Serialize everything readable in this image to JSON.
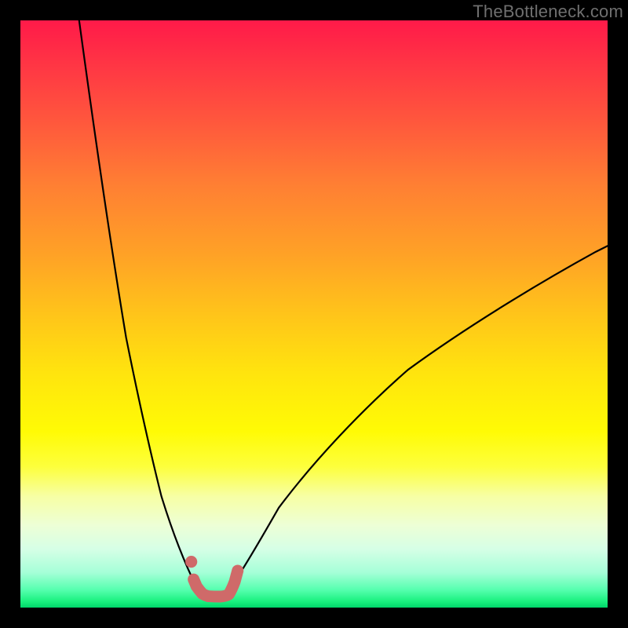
{
  "watermark": {
    "text": "TheBottleneck.com"
  },
  "chart_data": {
    "type": "line",
    "title": "",
    "xlabel": "",
    "ylabel": "",
    "xlim": [
      0,
      100
    ],
    "ylim": [
      0,
      100
    ],
    "grid": false,
    "legend": false,
    "series": [
      {
        "name": "left-curve",
        "x": [
          10,
          13,
          16,
          18,
          20,
          22,
          24,
          26,
          28,
          30,
          30.5
        ],
        "y": [
          100,
          78,
          58,
          46,
          36,
          27,
          19,
          12.5,
          7.5,
          3.5,
          3
        ]
      },
      {
        "name": "right-curve",
        "x": [
          35.5,
          37,
          40,
          44,
          50,
          58,
          66,
          76,
          88,
          98,
          100
        ],
        "y": [
          3,
          5,
          10,
          17,
          25,
          33.5,
          40.5,
          47.8,
          55.2,
          60.6,
          61.6
        ]
      },
      {
        "name": "highlight",
        "x": [
          29.1,
          29.5,
          30,
          30.5,
          31,
          31.5,
          32,
          33,
          34,
          35,
          35.5,
          36,
          36.5,
          37
        ],
        "y": [
          7.8,
          4.8,
          3.6,
          2.9,
          2.35,
          2.06,
          1.93,
          1.87,
          1.87,
          1.93,
          2.27,
          3.07,
          4.41,
          6.28
        ]
      }
    ],
    "point": {
      "x": 29.1,
      "y": 7.8
    }
  }
}
